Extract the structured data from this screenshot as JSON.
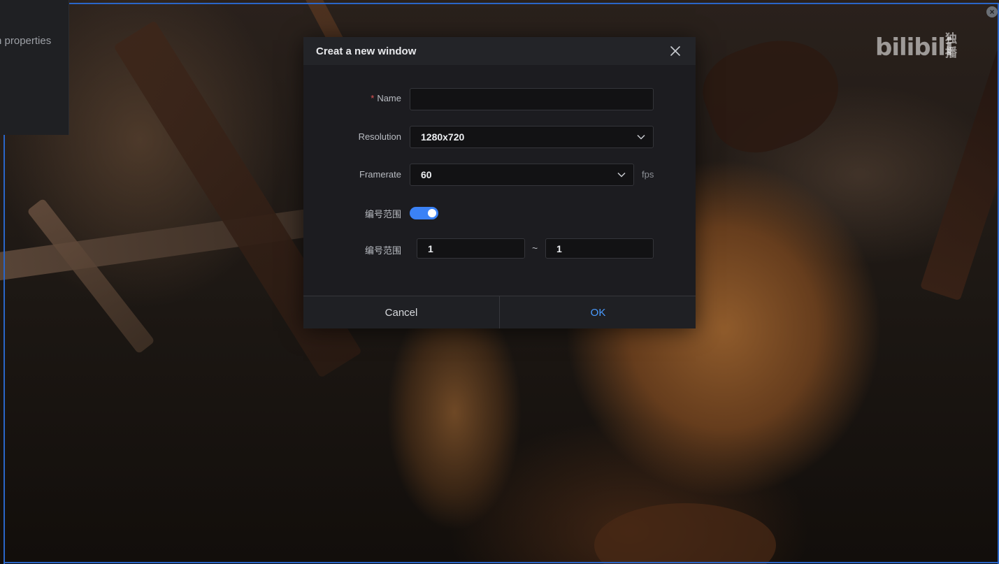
{
  "background": {
    "side_panel_title": "n properties",
    "watermark_text": "bilibili",
    "watermark_sub": "独播"
  },
  "colors": {
    "accent": "#3b82f6",
    "ok_text": "#4a9bff",
    "required": "#e05454",
    "frame_line": "#2a66c8"
  },
  "dialog": {
    "title": "Creat a new window",
    "close_icon": "close-icon",
    "name": {
      "label": "Name",
      "required_mark": "*",
      "value": "",
      "placeholder": ""
    },
    "resolution": {
      "label": "Resolution",
      "value": "1280x720"
    },
    "framerate": {
      "label": "Framerate",
      "value": "60",
      "unit": "fps"
    },
    "numbering_toggle": {
      "label": "编号范围",
      "enabled": true
    },
    "numbering_range": {
      "label": "编号范围",
      "from": "1",
      "separator": "~",
      "to": "1"
    },
    "cancel_label": "Cancel",
    "ok_label": "OK"
  }
}
